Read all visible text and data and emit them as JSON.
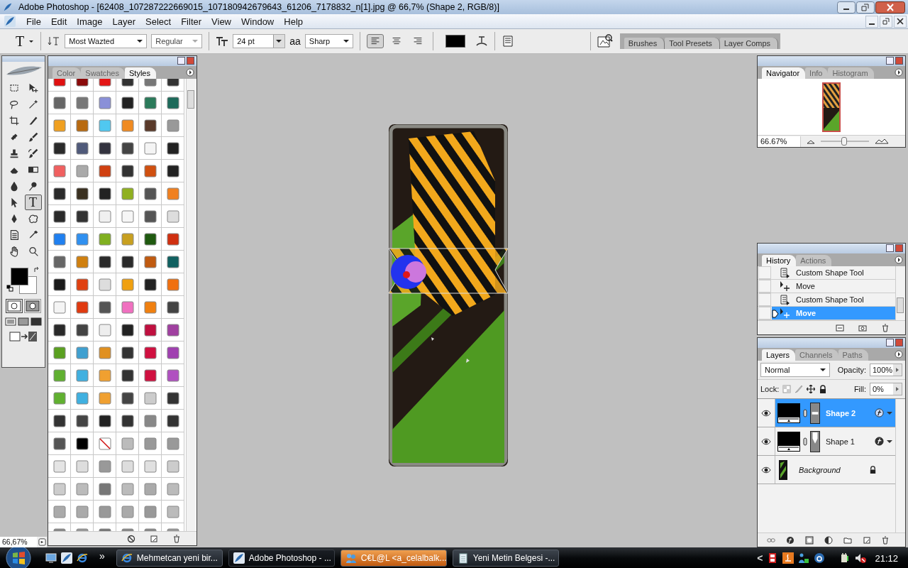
{
  "window": {
    "title": "Adobe Photoshop - [62408_107287222669015_107180942679643_61206_7178832_n[1].jpg @ 66,7% (Shape 2, RGB/8)]"
  },
  "menu": [
    "File",
    "Edit",
    "Image",
    "Layer",
    "Select",
    "Filter",
    "View",
    "Window",
    "Help"
  ],
  "options_bar": {
    "tool_glyph": "T",
    "font_family": "Most Wazted",
    "font_style": "Regular",
    "font_size": "24 pt",
    "antialias_glyph": "aa",
    "antialias": "Sharp",
    "align": [
      {
        "kind": "left",
        "selected": true
      },
      {
        "kind": "center",
        "selected": false
      },
      {
        "kind": "right",
        "selected": false
      }
    ],
    "palette_well": [
      "Brushes",
      "Tool Presets",
      "Layer Comps"
    ]
  },
  "toolbox": {
    "tools": [
      {
        "kind": "marquee",
        "selected": false
      },
      {
        "kind": "move",
        "selected": false
      },
      {
        "kind": "lasso",
        "selected": false
      },
      {
        "kind": "wand",
        "selected": false
      },
      {
        "kind": "crop",
        "selected": false
      },
      {
        "kind": "slice",
        "selected": false
      },
      {
        "kind": "healing",
        "selected": false
      },
      {
        "kind": "brush",
        "selected": false
      },
      {
        "kind": "stamp",
        "selected": false
      },
      {
        "kind": "hbrush",
        "selected": false
      },
      {
        "kind": "eraser",
        "selected": false
      },
      {
        "kind": "gradient",
        "selected": false
      },
      {
        "kind": "drop",
        "selected": false
      },
      {
        "kind": "dodge",
        "selected": false
      },
      {
        "kind": "arrow",
        "selected": false
      },
      {
        "kind": "type",
        "label": "T",
        "selected": true
      },
      {
        "kind": "pen",
        "selected": false
      },
      {
        "kind": "shape",
        "selected": false
      },
      {
        "kind": "notes",
        "selected": false
      },
      {
        "kind": "eyedropper",
        "selected": false
      },
      {
        "kind": "hand",
        "selected": false
      },
      {
        "kind": "zoom",
        "selected": false
      }
    ]
  },
  "styles_panel": {
    "tabs": [
      {
        "label": "Color",
        "selected": false
      },
      {
        "label": "Swatches",
        "selected": false
      },
      {
        "label": "Styles",
        "selected": true
      }
    ]
  },
  "navigator": {
    "tabs": [
      {
        "label": "Navigator",
        "selected": true
      },
      {
        "label": "Info",
        "selected": false
      },
      {
        "label": "Histogram",
        "selected": false
      }
    ],
    "zoom": "66.67%",
    "level": 0.48
  },
  "history": {
    "tabs": [
      {
        "label": "History",
        "selected": true
      },
      {
        "label": "Actions",
        "selected": false
      }
    ],
    "items": [
      {
        "label": "Custom Shape Tool",
        "kind": "shape",
        "selected": false
      },
      {
        "label": "Move",
        "kind": "move",
        "selected": false
      },
      {
        "label": "Custom Shape Tool",
        "kind": "shape",
        "selected": false
      },
      {
        "label": "Move",
        "kind": "move",
        "selected": true
      }
    ]
  },
  "layers": {
    "tabs": [
      {
        "label": "Layers",
        "selected": true
      },
      {
        "label": "Channels",
        "selected": false
      },
      {
        "label": "Paths",
        "selected": false
      }
    ],
    "blend_mode": "Normal",
    "opacity_label": "Opacity:",
    "opacity": "100%",
    "lock_label": "Lock:",
    "fill_label": "Fill:",
    "fill": "0%",
    "layers": [
      {
        "name": "Shape 2",
        "kind": "shape",
        "selected": true,
        "visible": true
      },
      {
        "name": "Shape 1",
        "kind": "shape",
        "selected": false,
        "visible": true
      },
      {
        "name": "Background",
        "kind": "background",
        "selected": false,
        "visible": true
      }
    ]
  },
  "status_bar": {
    "zoom": "66,67%"
  },
  "taskbar": {
    "chevron": "»",
    "tasks": [
      {
        "label": "Mehmetcan yeni bir...",
        "kind": "browser",
        "selected": false,
        "attention": false
      },
      {
        "label": "Adobe Photoshop - ...",
        "kind": "photoshop",
        "selected": true,
        "attention": false
      },
      {
        "label": "C€L@L <a_celalbalk...",
        "kind": "messenger",
        "selected": false,
        "attention": true
      },
      {
        "label": "Yeni Metin Belgesi -...",
        "kind": "notepad",
        "selected": false,
        "attention": false
      }
    ],
    "tray_chevron": "<",
    "clock": "21:12"
  }
}
